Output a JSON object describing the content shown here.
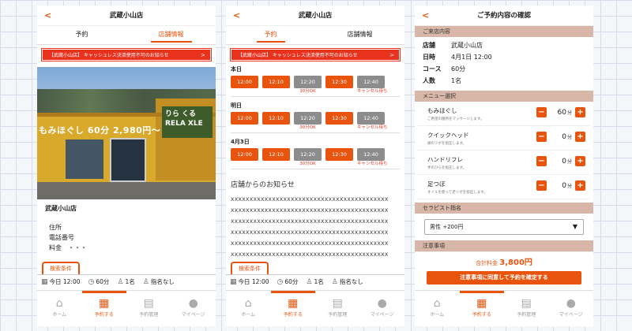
{
  "colors": {
    "accent": "#e8540e",
    "notice": "#e8321e",
    "section": "#d8b7a8"
  },
  "back": "<",
  "bottom_nav": [
    {
      "label": "ホーム",
      "icon": "home-icon"
    },
    {
      "label": "予約する",
      "icon": "calendar-store-icon"
    },
    {
      "label": "予約管理",
      "icon": "calendar-icon"
    },
    {
      "label": "マイページ",
      "icon": "person-icon"
    }
  ],
  "screen1": {
    "title": "武蔵小山店",
    "tabs": [
      "予約",
      "店舗情報"
    ],
    "active_tab": 1,
    "notice": "【武蔵小山店】 キャッシュレス決済使用不可のお知らせ",
    "notice_arrow": ">",
    "photo_sign": "もみほぐし 60分 2,980円〜",
    "photo_sign2": "りら くる RELA XLE",
    "store_name": "武蔵小山店",
    "rows": [
      "住所",
      "電話番号",
      "料金　・・・"
    ],
    "search_tab": "検索条件",
    "conditions": {
      "date": "今日 12:00",
      "duration": "60分",
      "people": "1名",
      "staff": "指名なし"
    }
  },
  "screen2": {
    "title": "武蔵小山店",
    "tabs": [
      "予約",
      "店舗情報"
    ],
    "active_tab": 0,
    "notice": "【武蔵小山店】 キャッシュレス決済使用不可のお知らせ",
    "notice_arrow": ">",
    "days": [
      {
        "label": "本日",
        "slots": [
          {
            "time": "12:00",
            "status": "open",
            "note": ""
          },
          {
            "time": "12:10",
            "status": "open",
            "note": ""
          },
          {
            "time": "12:20",
            "status": "gray",
            "note": "30分OK"
          },
          {
            "time": "12:30",
            "status": "open",
            "note": ""
          },
          {
            "time": "12:40",
            "status": "gray",
            "note": "キャンセル待ち"
          }
        ]
      },
      {
        "label": "明日",
        "slots": [
          {
            "time": "12:00",
            "status": "open",
            "note": ""
          },
          {
            "time": "12:10",
            "status": "open",
            "note": ""
          },
          {
            "time": "12:20",
            "status": "gray",
            "note": "30分OK"
          },
          {
            "time": "12:30",
            "status": "open",
            "note": ""
          },
          {
            "time": "12:40",
            "status": "gray",
            "note": "キャンセル待ち"
          }
        ]
      },
      {
        "label": "4月3日",
        "slots": [
          {
            "time": "12:00",
            "status": "open",
            "note": ""
          },
          {
            "time": "12:10",
            "status": "open",
            "note": ""
          },
          {
            "time": "12:20",
            "status": "gray",
            "note": "30分OK"
          },
          {
            "time": "12:30",
            "status": "open",
            "note": ""
          },
          {
            "time": "12:40",
            "status": "gray",
            "note": "キャンセル待ち"
          }
        ]
      }
    ],
    "news_title": "店舗からのお知らせ",
    "news_lines": [
      "XXXXXXXXXXXXXXXXXXXXXXXXXXXXXXXXXXXXXXXXXX",
      "XXXXXXXXXXXXXXXXXXXXXXXXXXXXXXXXXXXXXXXXXX",
      "XXXXXXXXXXXXXXXXXXXXXXXXXXXXXXXXXXXXXXXXXX",
      "XXXXXXXXXXXXXXXXXXXXXXXXXXXXXXXXXXXXXXXXXX",
      "XXXXXXXXXXXXXXXXXXXXXXXXXXXXXXXXXXXXXXXXXX",
      "XXXXXXXXXXXXXXXXXXXXXXXXXXXXXXXXXXXXXXXXXX"
    ],
    "search_tab": "検索条件",
    "conditions": {
      "date": "今日 12:00",
      "duration": "60分",
      "people": "1名",
      "staff": "指名なし"
    }
  },
  "screen3": {
    "title": "ご予約内容の確認",
    "visit_section": "ご来店内容",
    "visit": [
      {
        "k": "店舗",
        "v": "武蔵小山店"
      },
      {
        "k": "日時",
        "v": "4月1日 12:00"
      },
      {
        "k": "コース",
        "v": "60分"
      },
      {
        "k": "人数",
        "v": "1名"
      }
    ],
    "menu_section": "メニュー選択",
    "menus": [
      {
        "name": "もみほぐし",
        "desc": "ご希望の箇所をマッサージします。",
        "qty": "60",
        "unit": "分"
      },
      {
        "name": "クイックヘッド",
        "desc": "頭のツボを指圧します。",
        "qty": "0",
        "unit": "分"
      },
      {
        "name": "ハンドリフレ",
        "desc": "手のひらを指圧します。",
        "qty": "0",
        "unit": "分"
      },
      {
        "name": "足つぼ",
        "desc": "オイルを使って足ツボを指圧します。",
        "qty": "0",
        "unit": "分"
      }
    ],
    "therapist_section": "セラピスト指名",
    "therapist_value": "男性 +200円",
    "notes_section": "注意事項",
    "total_label": "合計料金",
    "total_value": "3,800円",
    "confirm_button": "注意事項に同意して予約を確定する"
  }
}
